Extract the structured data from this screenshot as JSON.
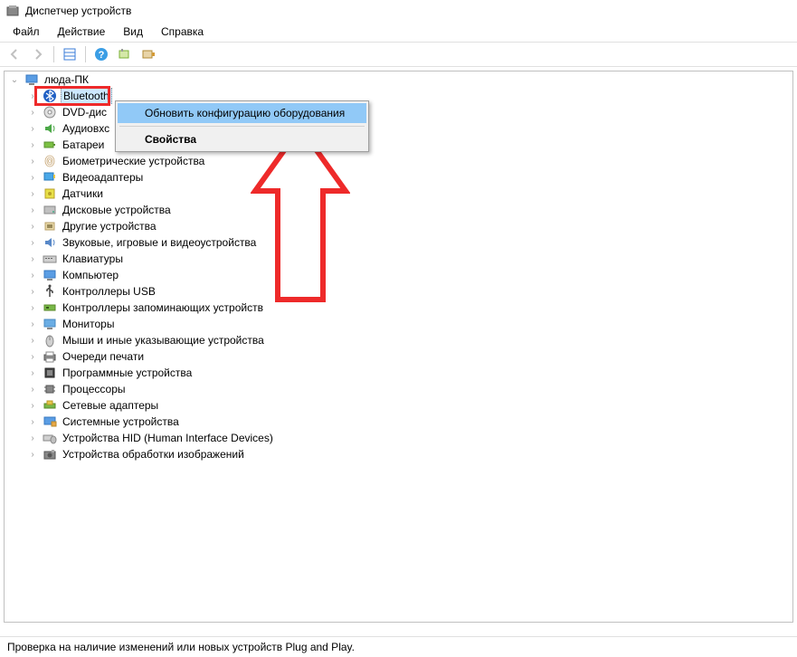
{
  "window": {
    "title": "Диспетчер устройств"
  },
  "menubar": {
    "file": "Файл",
    "action": "Действие",
    "view": "Вид",
    "help": "Справка"
  },
  "toolbar": {
    "back": "←",
    "forward": "→",
    "show_hidden": "▦",
    "help": "?",
    "monitor1": "▥",
    "monitor2": "▧"
  },
  "tree": {
    "root": "люда-ПК",
    "items": [
      "Bluetooth",
      "DVD-дис",
      "Аудиовхс",
      "Батареи",
      "Биометрические устройства",
      "Видеоадаптеры",
      "Датчики",
      "Дисковые устройства",
      "Другие устройства",
      "Звуковые, игровые и видеоустройства",
      "Клавиатуры",
      "Компьютер",
      "Контроллеры USB",
      "Контроллеры запоминающих устройств",
      "Мониторы",
      "Мыши и иные указывающие устройства",
      "Очереди печати",
      "Программные устройства",
      "Процессоры",
      "Сетевые адаптеры",
      "Системные устройства",
      "Устройства HID (Human Interface Devices)",
      "Устройства обработки изображений"
    ]
  },
  "context_menu": {
    "scan": "Обновить конфигурацию оборудования",
    "properties": "Свойства"
  },
  "statusbar": {
    "text": "Проверка на наличие изменений или новых устройств Plug and Play."
  },
  "icons": {
    "bluetooth": "bluetooth",
    "dvd": "disc",
    "audio_in": "audio",
    "battery": "battery",
    "biometric": "fingerprint",
    "video": "display",
    "sensor": "sensor",
    "disk": "hdd",
    "other": "other",
    "sound": "speaker",
    "keyboard": "keyboard",
    "computer": "monitor",
    "usb": "usb",
    "storage": "storage",
    "monitors": "monitor",
    "mouse": "mouse",
    "printer": "printer",
    "software": "software",
    "cpu": "cpu",
    "network": "network",
    "system": "system",
    "hid": "hid",
    "imaging": "camera"
  },
  "annotation": {
    "color": "#ee2a2a"
  }
}
